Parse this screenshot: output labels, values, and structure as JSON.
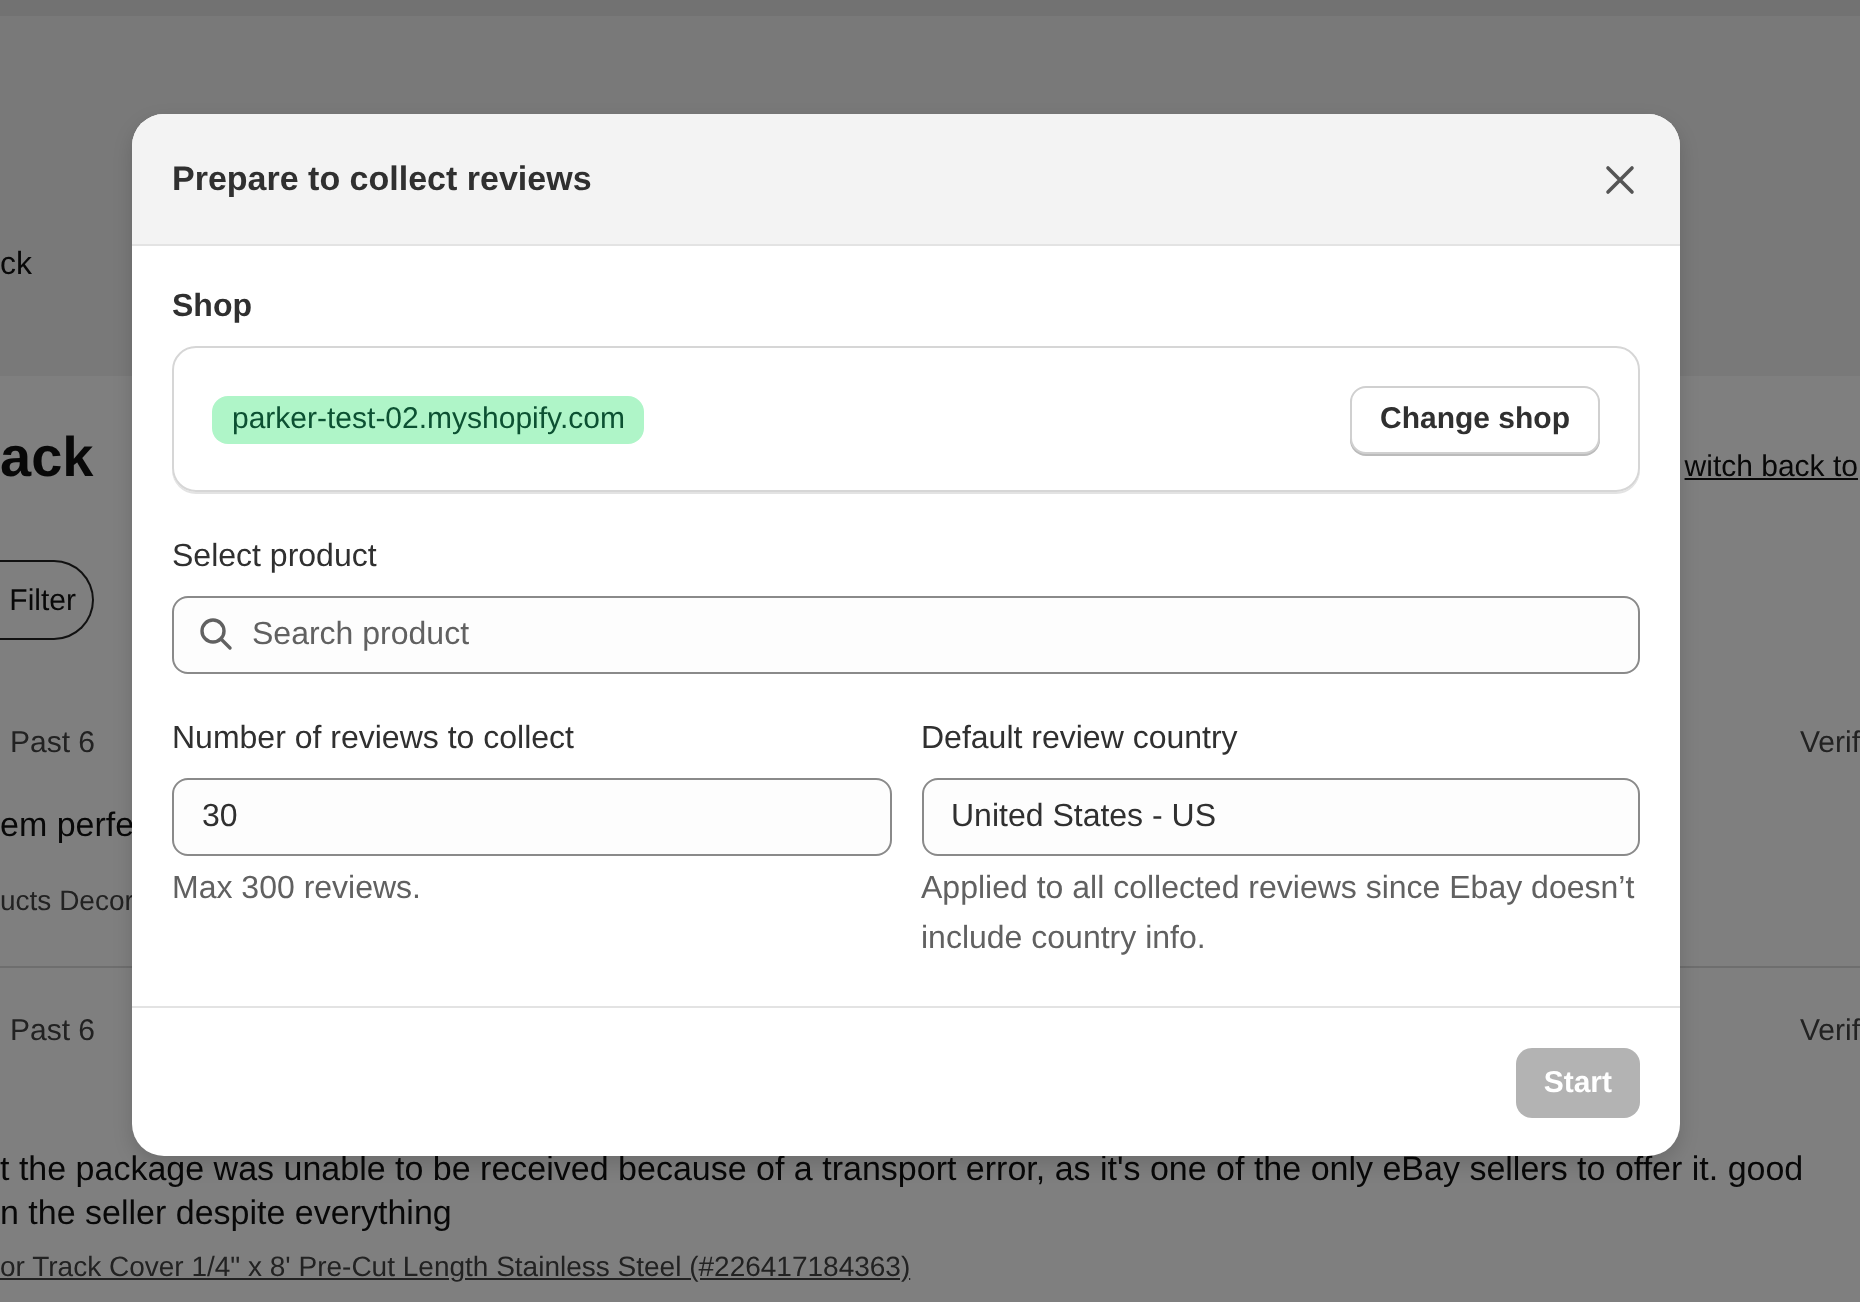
{
  "background_page": {
    "header_text": "ck",
    "title": "ack",
    "switch_link": "witch back to",
    "filter_button": "Filter",
    "reviews": [
      {
        "meta": "Past 6",
        "status": "Verif",
        "lines": [
          "em perfe"
        ],
        "product": "ucts Decor",
        "product_link": false
      },
      {
        "meta": "Past 6",
        "status": "Verif",
        "lines": [
          "t the package was unable to be received because of a transport error, as it's one of the only eBay sellers to offer it. good",
          "n the seller despite everything"
        ],
        "product": "or Track Cover 1/4\" x 8' Pre-Cut Length Stainless Steel (#226417184363)",
        "product_link": true
      }
    ]
  },
  "dialog": {
    "title": "Prepare to collect reviews",
    "close": true,
    "shop": {
      "label": "Shop",
      "domain": "parker-test-02.myshopify.com",
      "button": "Change shop"
    },
    "product": {
      "label": "Select product",
      "placeholder": "Search product"
    },
    "fields": [
      {
        "label": "Number of reviews to collect",
        "value": "30",
        "help": "Max 300 reviews."
      },
      {
        "label": "Default review country",
        "value": "United States - US",
        "help": "Applied to all collected reviews since Ebay doesn’t include country info."
      }
    ],
    "start_button": {
      "label": "Start",
      "disabled": true
    }
  }
}
